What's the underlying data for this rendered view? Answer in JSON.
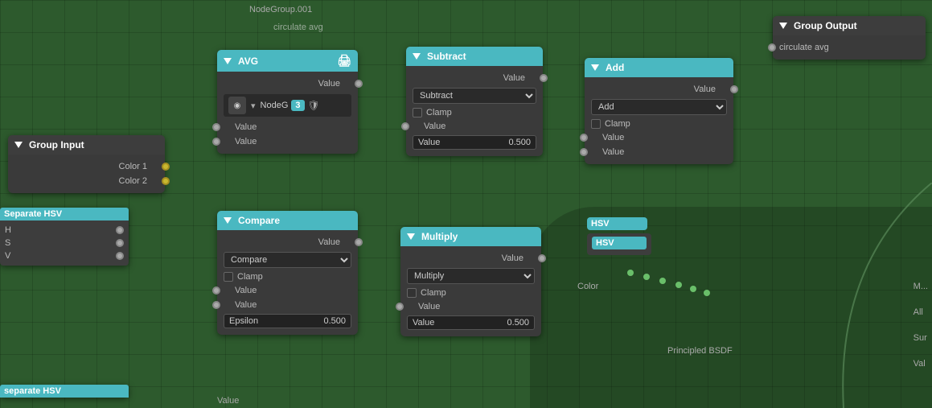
{
  "canvas": {
    "background_color": "#2d5a2d"
  },
  "top_label": {
    "text": "circulate avg",
    "nodegroup_label": "NodeGroup.001"
  },
  "nodes": {
    "group_output": {
      "title": "Group Output",
      "output_label": "circulate avg",
      "header_color": "#3d3d3d"
    },
    "avg": {
      "title": "AVG",
      "value_label": "Value",
      "node_field": "NodeG",
      "badge_number": "3"
    },
    "subtract": {
      "title": "Subtract",
      "value_label": "Value",
      "dropdown_value": "Subtract",
      "clamp_label": "Clamp",
      "value_input_label": "Value",
      "value_input_num": "0.500"
    },
    "add": {
      "title": "Add",
      "value_label": "Value",
      "dropdown_value": "Add",
      "clamp_label": "Clamp",
      "value1_label": "Value",
      "value2_label": "Value"
    },
    "group_input": {
      "title": "Group Input",
      "color1_label": "Color 1",
      "color2_label": "Color 2"
    },
    "compare": {
      "title": "Compare",
      "value_label": "Value",
      "dropdown_value": "Compare",
      "clamp_label": "Clamp",
      "value1_label": "Value",
      "value2_label": "Value",
      "epsilon_label": "Epsilon",
      "epsilon_num": "0.500"
    },
    "multiply": {
      "title": "Multiply",
      "value_label": "Value",
      "dropdown_value": "Multiply",
      "clamp_label": "Clamp",
      "value_input_label": "Value",
      "value_input_num": "0.500"
    }
  },
  "partial_nodes": {
    "separate_hsv_top": {
      "tag": "Separate HSV",
      "h_label": "H",
      "s_label": "S",
      "v_label": "V"
    },
    "separate_hsv_bottom": {
      "tag": "separate HSV"
    },
    "color_label": "Color",
    "principled_bsdf": "Principled BSDF",
    "all_label": "All",
    "sur_label": "Sur",
    "val_label": "Val"
  },
  "icons": {
    "triangle_down": "▼",
    "printer": "🖨",
    "shield": "🛡",
    "sphere": "◉",
    "dropdown_arrow": "▾"
  }
}
